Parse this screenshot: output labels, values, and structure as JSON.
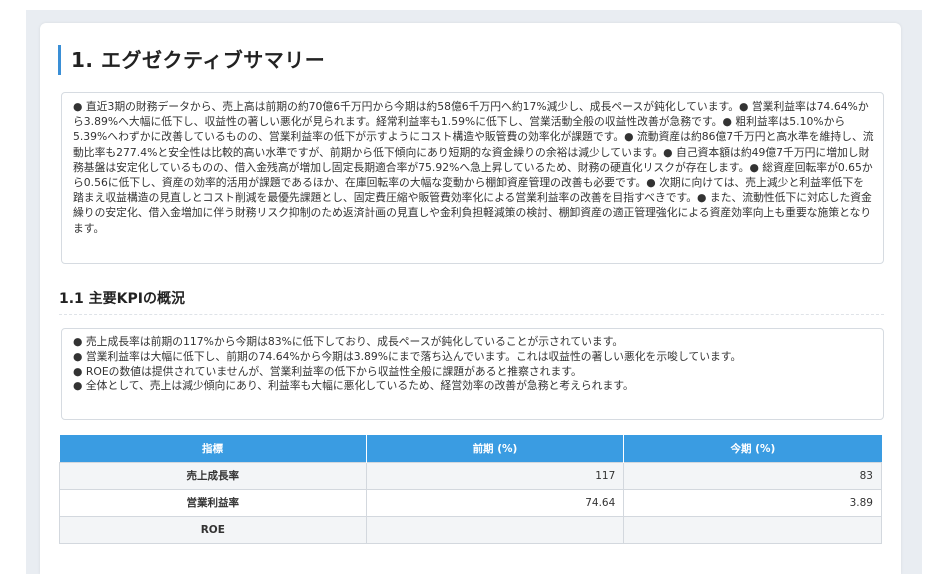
{
  "section": {
    "title": "1. エグゼクティブサマリー"
  },
  "summary": {
    "text": "● 直近3期の財務データから、売上高は前期の約70億6千万円から今期は約58億6千万円へ約17%減少し、成長ペースが鈍化しています。● 営業利益率は74.64%から3.89%へ大幅に低下し、収益性の著しい悪化が見られます。経常利益率も1.59%に低下し、営業活動全般の収益性改善が急務です。● 粗利益率は5.10%から5.39%へわずかに改善しているものの、営業利益率の低下が示すようにコスト構造や販管費の効率化が課題です。● 流動資産は約86億7千万円と高水準を維持し、流動比率も277.4%と安全性は比較的高い水準ですが、前期から低下傾向にあり短期的な資金繰りの余裕は減少しています。● 自己資本額は約49億7千万円に増加し財務基盤は安定化しているものの、借入金残高が増加し固定長期適合率が75.92%へ急上昇しているため、財務の硬直化リスクが存在します。● 総資産回転率が0.65から0.56に低下し、資産の効率的活用が課題であるほか、在庫回転率の大幅な変動から棚卸資産管理の改善も必要です。● 次期に向けては、売上減少と利益率低下を踏まえ収益構造の見直しとコスト削減を最優先課題とし、固定費圧縮や販管費効率化による営業利益率の改善を目指すべきです。● また、流動性低下に対応した資金繰りの安定化、借入金増加に伴う財務リスク抑制のため返済計画の見直しや金利負担軽減策の検討、棚卸資産の適正管理強化による資産効率向上も重要な施策となります。"
  },
  "kpi": {
    "title": "1.1 主要KPIの概況",
    "bullets": [
      "● 売上成長率は前期の117%から今期は83%に低下しており、成長ペースが鈍化していることが示されています。",
      "● 営業利益率は大幅に低下し、前期の74.64%から今期は3.89%にまで落ち込んでいます。これは収益性の著しい悪化を示唆しています。",
      "● ROEの数値は提供されていませんが、営業利益率の低下から収益性全般に課題があると推察されます。",
      "● 全体として、売上は減少傾向にあり、利益率も大幅に悪化しているため、経営効率の改善が急務と考えられます。"
    ]
  },
  "table": {
    "headers": [
      "指標",
      "前期 (%)",
      "今期 (%)"
    ],
    "rows": [
      [
        "売上成長率",
        "117",
        "83"
      ],
      [
        "営業利益率",
        "74.64",
        "3.89"
      ],
      [
        "ROE",
        "",
        ""
      ]
    ]
  },
  "colors": {
    "accent": "#3a8fd6",
    "table_header": "#3a9ce2",
    "page_background": "#e9edf2"
  }
}
